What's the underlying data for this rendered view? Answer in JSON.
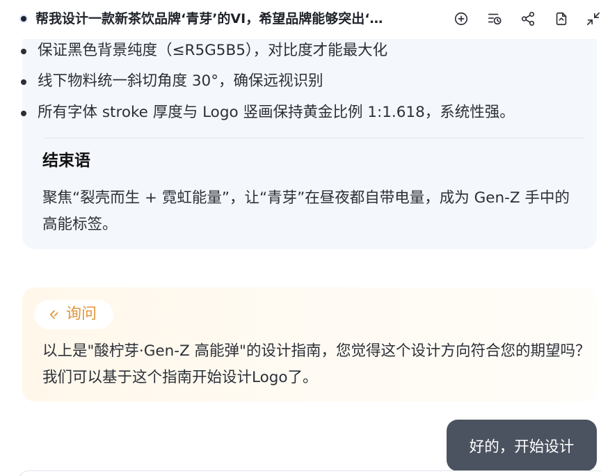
{
  "header": {
    "title": "帮我设计一款新茶饮品牌‘青芽’的VI，希望品牌能够突出‘…",
    "icons": [
      "new-chat-icon",
      "history-icon",
      "share-icon",
      "export-icon",
      "collapse-icon"
    ]
  },
  "guide": {
    "bullets": [
      "保证黑色背景纯度（≤R5G5B5），对比度才能最大化",
      "线下物料统一斜切角度 30°，确保远视识别",
      "所有字体 stroke 厚度与 Logo 竖画保持黄金比例 1:1.618，系统性强。"
    ],
    "conclusion_heading": "结束语",
    "conclusion_text": "聚焦“裂壳而生 + 霓虹能量”，让“青芽”在昼夜都自带电量，成为 Gen-Z 手中的高能标签。"
  },
  "inquiry": {
    "badge_label": "询问",
    "text": "以上是\"酸柠芽·Gen-Z 高能弹\"的设计指南，您觉得这个设计方向符合您的期望吗？我们可以基于这个指南开始设计Logo了。"
  },
  "user_message": {
    "text": "好的，开始设计"
  },
  "colors": {
    "guide_card_bg": "#f4f8fd",
    "inquiry_accent": "#e0953c",
    "user_bubble_bg": "#4c5360"
  }
}
